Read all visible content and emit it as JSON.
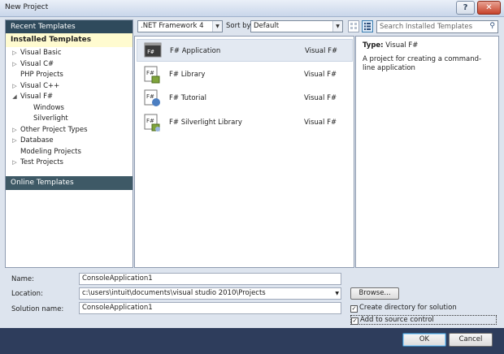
{
  "window": {
    "title": "New Project",
    "help_button": "?",
    "close_button": "✕"
  },
  "left_pane": {
    "recent_templates": "Recent Templates",
    "installed_templates": "Installed Templates",
    "tree": [
      {
        "label": "Visual Basic",
        "arrow": "▷"
      },
      {
        "label": "Visual C#",
        "arrow": "▷"
      },
      {
        "label": "PHP Projects",
        "arrow": ""
      },
      {
        "label": "Visual C++",
        "arrow": "▷"
      },
      {
        "label": "Visual F#",
        "arrow": "◢"
      },
      {
        "label": "Windows",
        "arrow": ""
      },
      {
        "label": "Silverlight",
        "arrow": ""
      },
      {
        "label": "Other Project Types",
        "arrow": "▷"
      },
      {
        "label": "Database",
        "arrow": "▷"
      },
      {
        "label": "Modeling Projects",
        "arrow": ""
      },
      {
        "label": "Test Projects",
        "arrow": "▷"
      }
    ],
    "online_templates": "Online Templates"
  },
  "toolbar": {
    "framework": ".NET Framework 4",
    "sort_label": "Sort by:",
    "sort_value": "Default",
    "search_placeholder": "Search Installed Templates"
  },
  "templates": [
    {
      "name": "F# Application",
      "language": "Visual F#",
      "selected": true
    },
    {
      "name": "F# Library",
      "language": "Visual F#",
      "selected": false
    },
    {
      "name": "F# Tutorial",
      "language": "Visual F#",
      "selected": false
    },
    {
      "name": "F# Silverlight Library",
      "language": "Visual F#",
      "selected": false
    }
  ],
  "details": {
    "type_label": "Type:",
    "type_value": "Visual F#",
    "description": "A project for creating a command-line application"
  },
  "form": {
    "name_label": "Name:",
    "name_value": "ConsoleApplication1",
    "location_label": "Location:",
    "location_value": "c:\\users\\intuit\\documents\\visual studio 2010\\Projects",
    "solution_label": "Solution name:",
    "solution_value": "ConsoleApplication1",
    "browse_label": "Browse...",
    "create_dir_label": "Create directory for solution",
    "create_dir_checked": true,
    "source_control_label": "Add to source control",
    "source_control_checked": true
  },
  "buttons": {
    "ok": "OK",
    "cancel": "Cancel"
  }
}
